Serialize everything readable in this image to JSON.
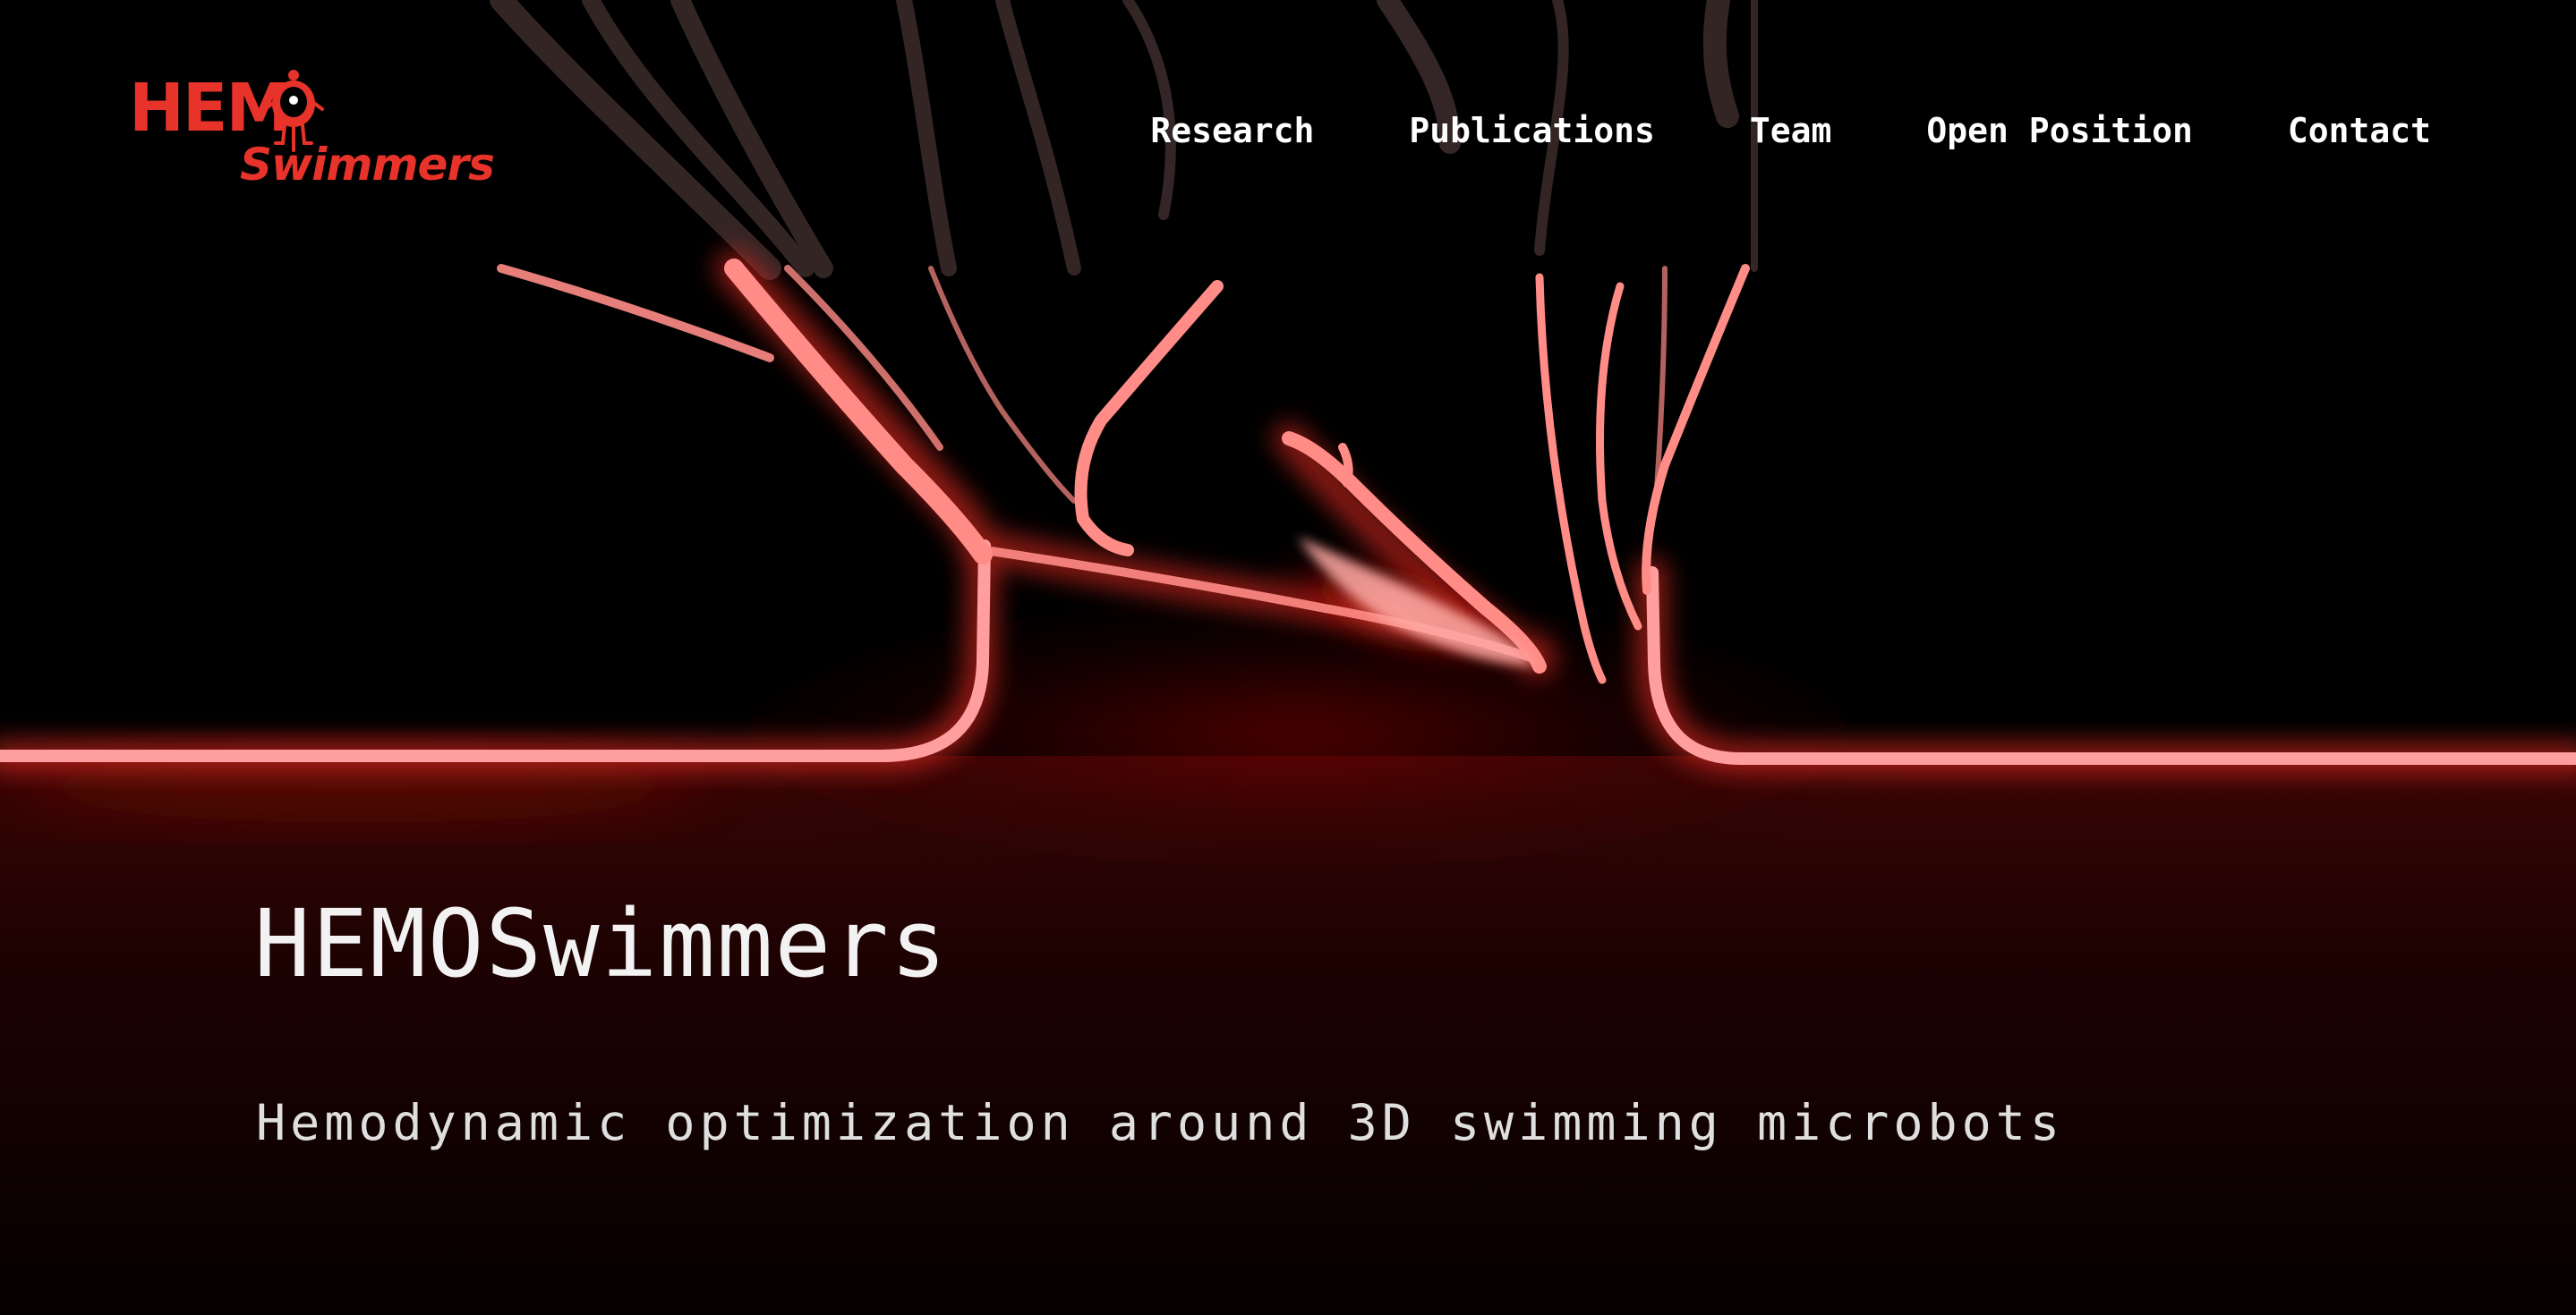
{
  "logo": {
    "line1": "HEM",
    "line2": "Swimmers"
  },
  "nav": {
    "items": [
      {
        "label": "Research"
      },
      {
        "label": "Publications"
      },
      {
        "label": "Team"
      },
      {
        "label": "Open Position"
      },
      {
        "label": "Contact"
      }
    ]
  },
  "hero": {
    "title": "HEMOSwimmers",
    "subtitle": "Hemodynamic optimization around 3D swimming microbots"
  },
  "colors": {
    "accent": "#e8332a",
    "background": "#000000",
    "text": "#ffffff",
    "glow": "#ff9a9a"
  }
}
